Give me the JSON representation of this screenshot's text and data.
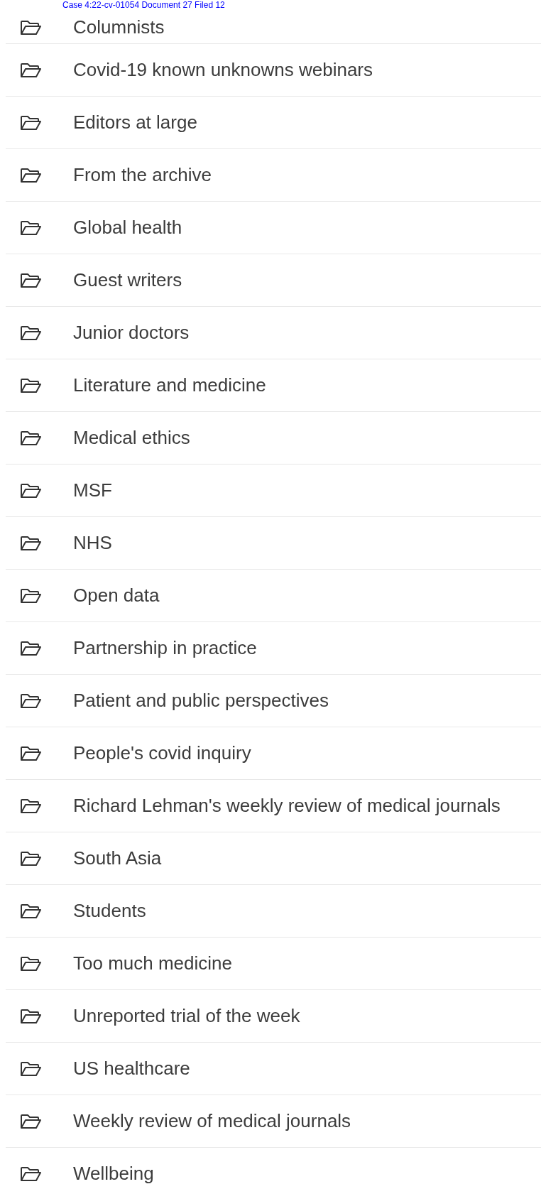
{
  "header_stamp": "Case 4:22-cv-01054 Document 27 Filed 12",
  "categories": [
    {
      "label": "Columnists"
    },
    {
      "label": "Covid-19 known unknowns webinars"
    },
    {
      "label": "Editors at large"
    },
    {
      "label": "From the archive"
    },
    {
      "label": "Global health"
    },
    {
      "label": "Guest writers"
    },
    {
      "label": "Junior doctors"
    },
    {
      "label": "Literature and medicine"
    },
    {
      "label": "Medical ethics"
    },
    {
      "label": "MSF"
    },
    {
      "label": "NHS"
    },
    {
      "label": "Open data"
    },
    {
      "label": "Partnership in practice"
    },
    {
      "label": "Patient and public perspectives"
    },
    {
      "label": "People's covid inquiry"
    },
    {
      "label": "Richard Lehman's weekly review of medical journals"
    },
    {
      "label": "South Asia"
    },
    {
      "label": "Students"
    },
    {
      "label": "Too much medicine"
    },
    {
      "label": "Unreported trial of the week"
    },
    {
      "label": "US healthcare"
    },
    {
      "label": "Weekly review of medical journals"
    },
    {
      "label": "Wellbeing"
    }
  ]
}
